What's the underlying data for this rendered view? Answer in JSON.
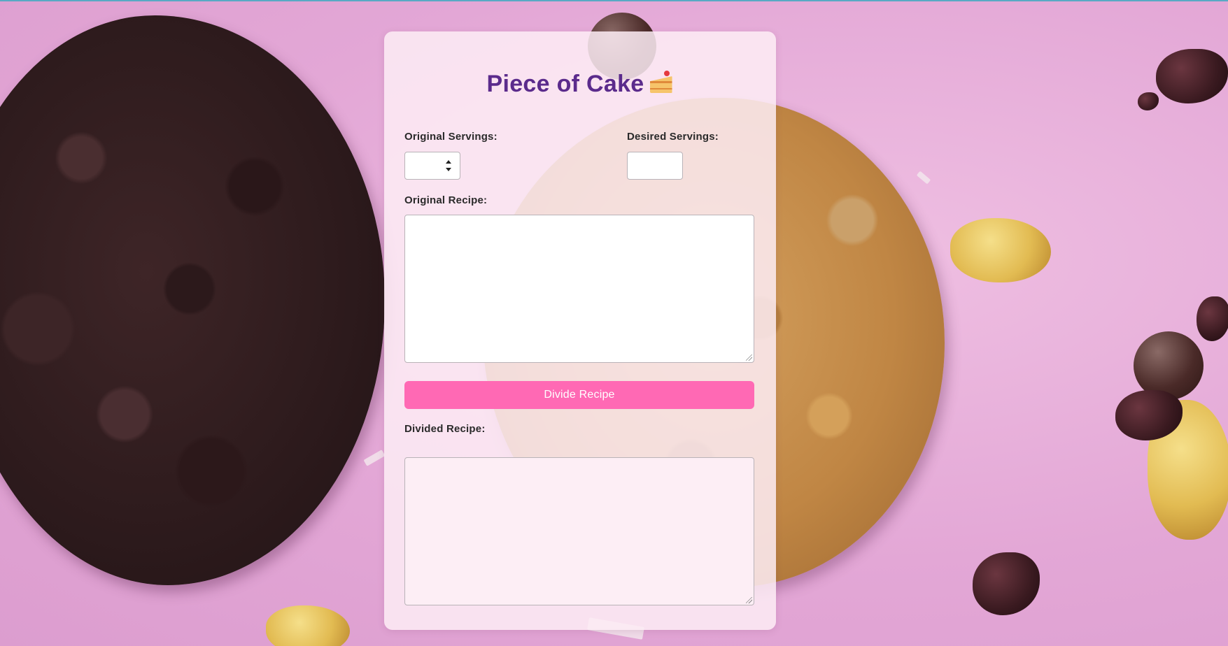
{
  "app": {
    "title": "Piece of Cake",
    "title_icon": "cake-slice-icon"
  },
  "form": {
    "original_servings_label": "Original Servings:",
    "original_servings_value": "",
    "desired_servings_label": "Desired Servings:",
    "desired_servings_value": "",
    "original_recipe_label": "Original Recipe:",
    "original_recipe_value": "",
    "divide_button_label": "Divide Recipe",
    "divided_recipe_label": "Divided Recipe:",
    "divided_recipe_value": ""
  },
  "colors": {
    "title": "#5b2b8c",
    "button": "#ff69b4",
    "background": "#e5a9d8"
  }
}
